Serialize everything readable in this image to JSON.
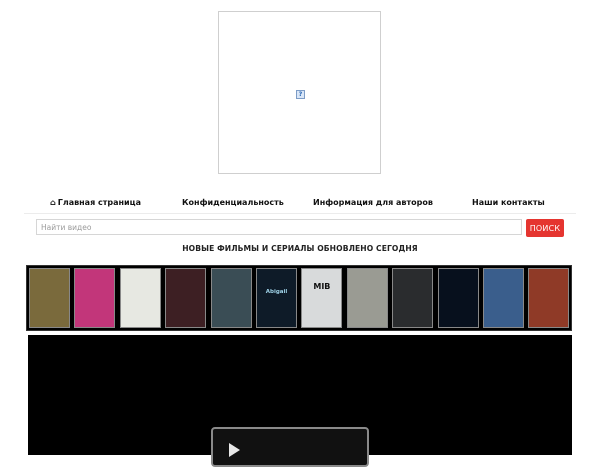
{
  "nav": {
    "home_label": "Главная страница",
    "privacy_label": "Конфиденциальность",
    "authors_label": "Информация для авторов",
    "contacts_label": "Наши контакты"
  },
  "search": {
    "placeholder": "Найти видео",
    "button_label": "ПОИСК"
  },
  "headline": "НОВЫЕ ФИЛЬМЫ И СЕРИАЛЫ ОБНОВЛЕНО СЕГОДНЯ",
  "posters": [
    {
      "caption": "",
      "bg": "#7a6a3c"
    },
    {
      "caption": "",
      "bg": "#c2367a"
    },
    {
      "caption": "",
      "bg": "#e7e8e2"
    },
    {
      "caption": "",
      "bg": "#3d1f23"
    },
    {
      "caption": "",
      "bg": "#3a4d55"
    },
    {
      "caption": "Abigail",
      "bg": "#0e1b28"
    },
    {
      "caption": "MIB",
      "bg": "#d8dadb"
    },
    {
      "caption": "",
      "bg": "#9a9b93"
    },
    {
      "caption": "",
      "bg": "#2a2c2e"
    },
    {
      "caption": "",
      "bg": "#07101d"
    },
    {
      "caption": "",
      "bg": "#3a5e8c"
    },
    {
      "caption": "",
      "bg": "#8f3a27"
    }
  ],
  "colors": {
    "accent": "#e53530",
    "strip_bg": "#000000"
  },
  "icons": {
    "home": "home-icon",
    "broken_image": "broken-image-icon",
    "play": "play-icon"
  }
}
